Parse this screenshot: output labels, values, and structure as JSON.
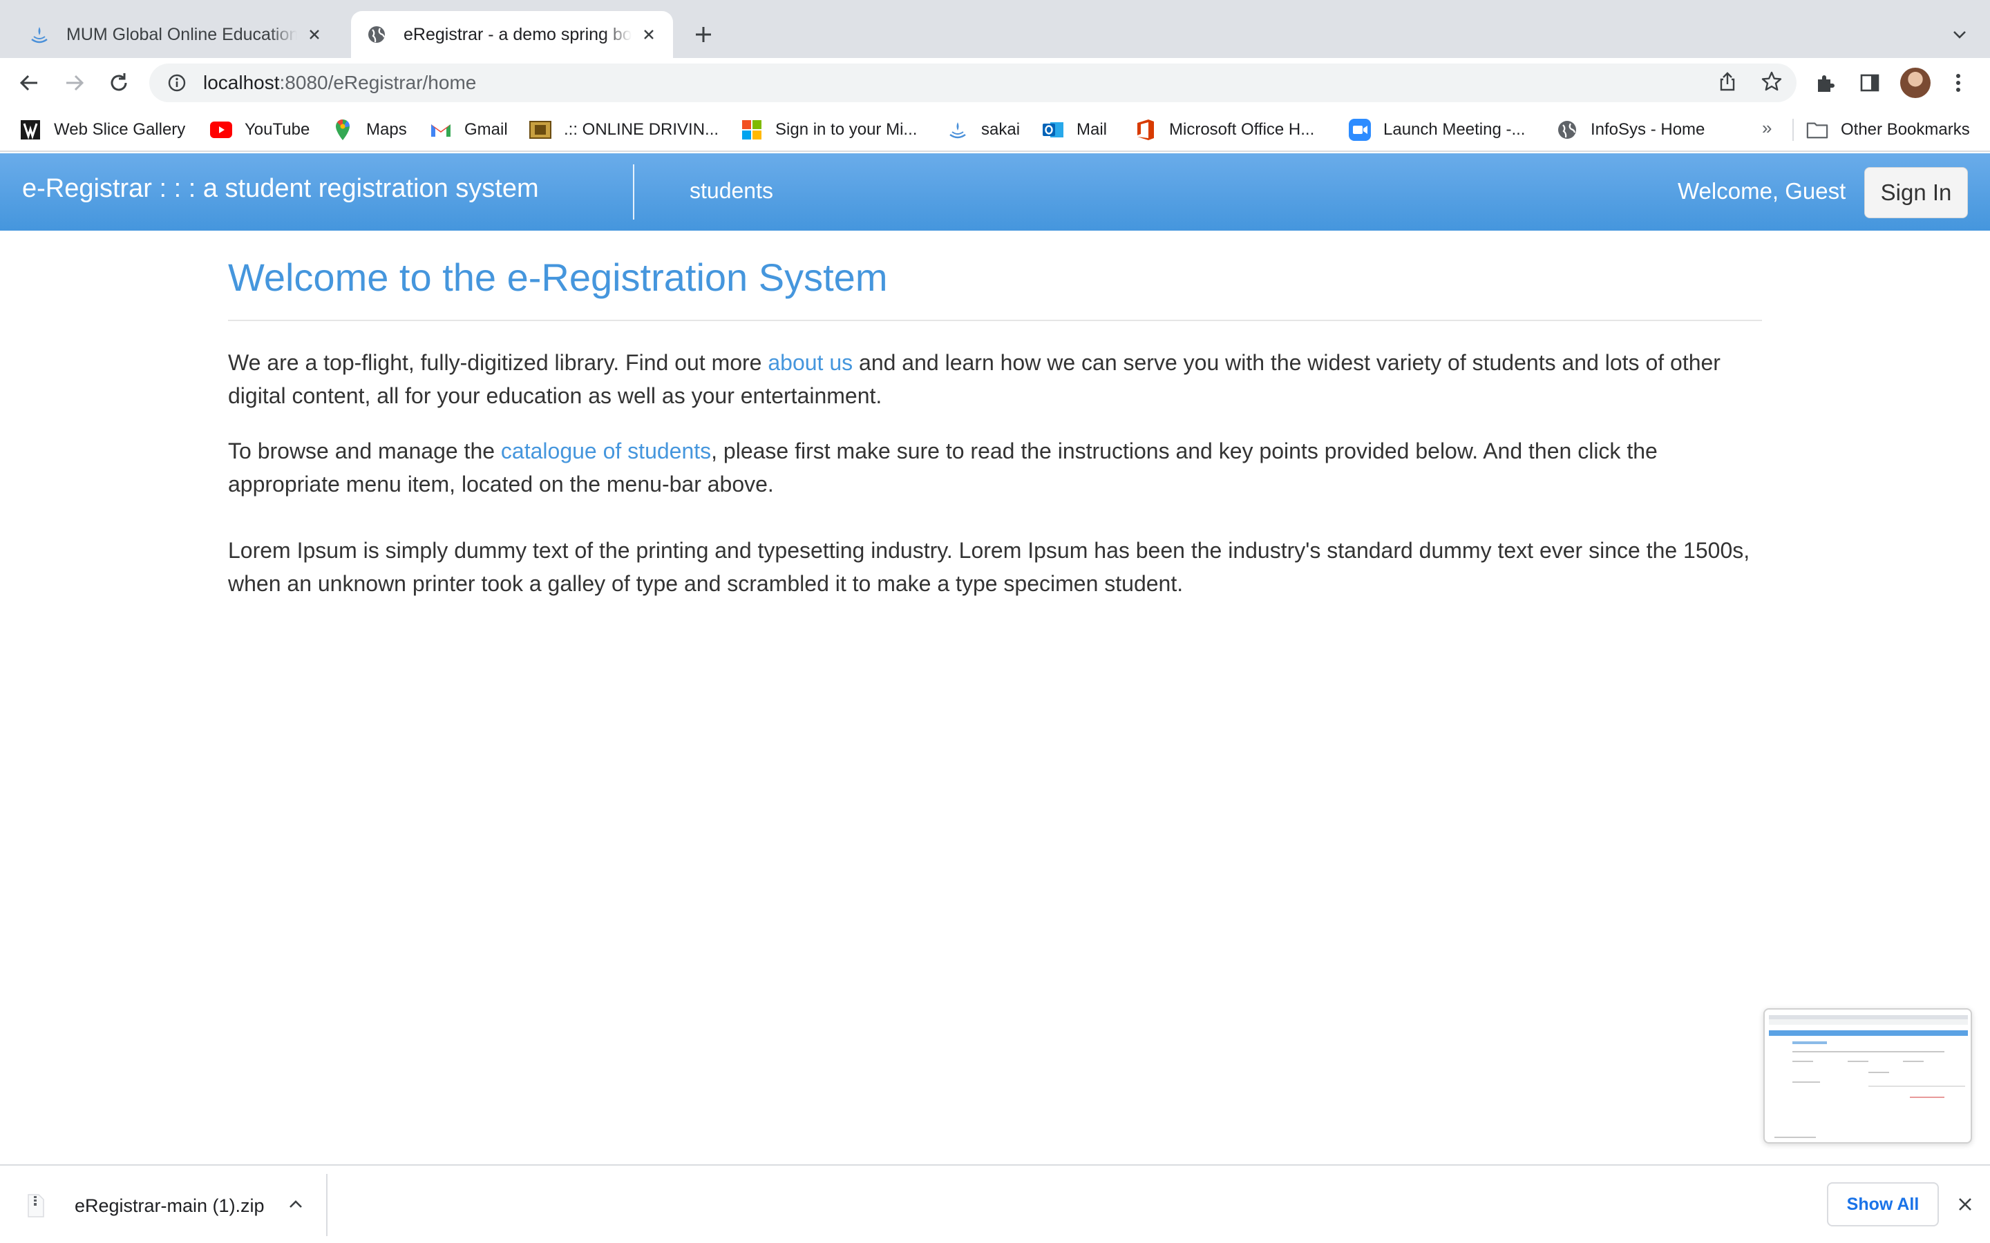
{
  "browser": {
    "tabs": [
      {
        "title": "MUM Global Online Education",
        "active": false,
        "icon": "sakai-fountain-icon"
      },
      {
        "title": "eRegistrar - a demo spring boot",
        "active": true,
        "icon": "globe-icon"
      }
    ],
    "url_host": "localhost",
    "url_rest": ":8080/eRegistrar/home",
    "bookmarks": [
      {
        "label": "Web Slice Gallery",
        "icon": "web-slice-icon"
      },
      {
        "label": "YouTube",
        "icon": "youtube-icon"
      },
      {
        "label": "Maps",
        "icon": "maps-pin-icon"
      },
      {
        "label": "Gmail",
        "icon": "gmail-icon"
      },
      {
        "label": ".:: ONLINE DRIVIN...",
        "icon": "film-icon"
      },
      {
        "label": "Sign in to your Mi...",
        "icon": "microsoft-icon"
      },
      {
        "label": "sakai",
        "icon": "sakai-fountain-icon"
      },
      {
        "label": "Mail",
        "icon": "outlook-icon"
      },
      {
        "label": "Microsoft Office H...",
        "icon": "office-icon"
      },
      {
        "label": "Launch Meeting -...",
        "icon": "zoom-icon"
      },
      {
        "label": "InfoSys - Home",
        "icon": "globe-icon"
      }
    ],
    "bookmarks_more": "»",
    "other_bookmarks": "Other Bookmarks"
  },
  "navbar": {
    "brand": "e-Registrar : : : a student registration system",
    "students_link": "students",
    "welcome": "Welcome, Guest",
    "sign_in": "Sign In"
  },
  "main": {
    "heading": "Welcome to the e-Registration System",
    "p1_before": "We are a top-flight, fully-digitized library. Find out more ",
    "p1_link": "about us",
    "p1_after": " and and learn how we can serve you with the widest variety of students and lots of other digital content, all for your education as well as your entertainment.",
    "p2_before": "To browse and manage the ",
    "p2_link": "catalogue of students",
    "p2_after": ", please first make sure to read the instructions and key points provided below. And then click the appropriate menu item, located on the menu-bar above.",
    "p3": "Lorem Ipsum is simply dummy text of the printing and typesetting industry. Lorem Ipsum has been the industry's standard dummy text ever since the 1500s, when an unknown printer took a galley of type and scrambled it to make a type specimen student."
  },
  "downloads": {
    "file": "eRegistrar-main (1).zip",
    "show_all": "Show All"
  },
  "colors": {
    "accent": "#4596dd",
    "navbar_top": "#6aacea",
    "navbar_bottom": "#4596dd",
    "chrome_tabstrip": "#dee1e6",
    "download_link": "#1a73e8"
  }
}
